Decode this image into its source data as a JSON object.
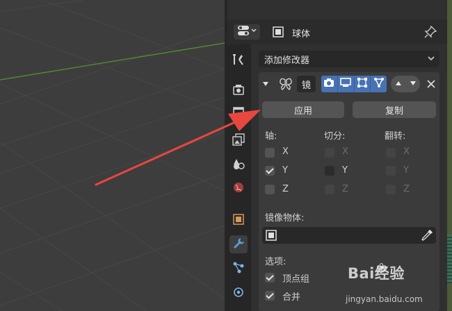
{
  "header": {
    "object_name": "球体"
  },
  "modifiers": {
    "add_label": "添加修改器",
    "name": "镜",
    "apply_label": "应用",
    "copy_label": "复制"
  },
  "mirror": {
    "axis_label": "轴:",
    "bisect_label": "切分:",
    "flip_label": "翻转:",
    "axes": [
      "X",
      "Y",
      "Z"
    ],
    "axis_checked": [
      false,
      true,
      false
    ],
    "bisect_checked": [
      false,
      false,
      false
    ],
    "flip_checked": [
      false,
      false,
      false
    ],
    "mirror_object_label": "镜像物体:",
    "options_label": "选项:",
    "vertex_groups_label": "顶点组",
    "vertex_groups_checked": true,
    "merge_label": "合并",
    "merge_checked": true
  },
  "watermark": {
    "brand": "Bai经验",
    "url": "jingyan.baidu.com"
  },
  "colors": {
    "accent": "#4772b3",
    "arrow": "#e8473f",
    "grid_x_axis": "#4e8b2e"
  },
  "icons": {
    "editor_type": "properties-editor-icon",
    "object": "object-square-icon",
    "pin": "pin-icon",
    "mirror_modifier": "mirror-butterfly-icon"
  }
}
